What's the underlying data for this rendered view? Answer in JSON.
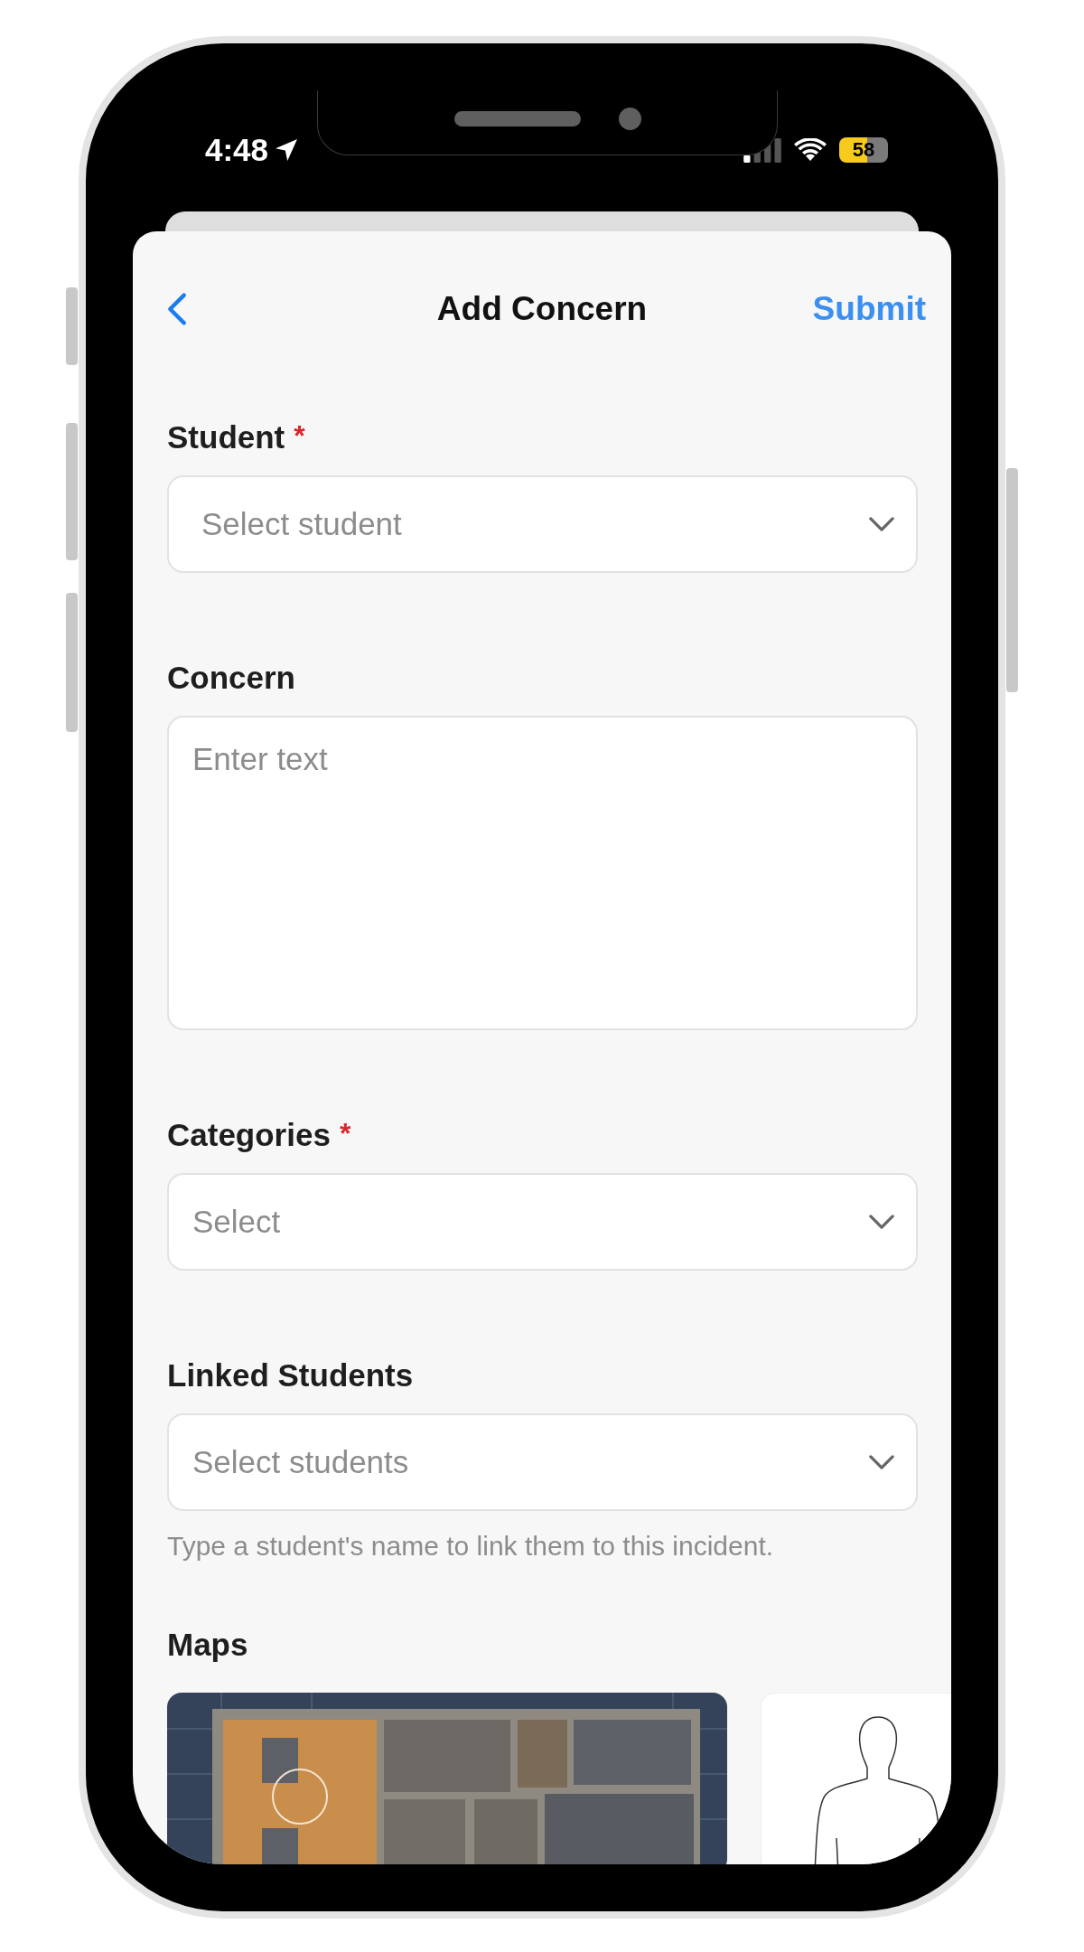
{
  "status_bar": {
    "time": "4:48",
    "battery": "58"
  },
  "header": {
    "title": "Add Concern",
    "action": "Submit"
  },
  "required_mark": "*",
  "fields": [
    {
      "kind": "select",
      "label": "Student",
      "required": true,
      "placeholder": "Select student"
    },
    {
      "kind": "textarea",
      "label": "Concern",
      "required": false,
      "placeholder": "Enter text"
    },
    {
      "kind": "select",
      "label": "Categories",
      "required": true,
      "placeholder": "Select"
    },
    {
      "kind": "select",
      "label": "Linked Students",
      "required": false,
      "placeholder": "Select students",
      "hint": "Type a student's name to link them to this incident."
    }
  ],
  "maps": {
    "label": "Maps",
    "items": [
      {
        "kind": "picture"
      },
      {
        "kind": "body"
      }
    ]
  }
}
